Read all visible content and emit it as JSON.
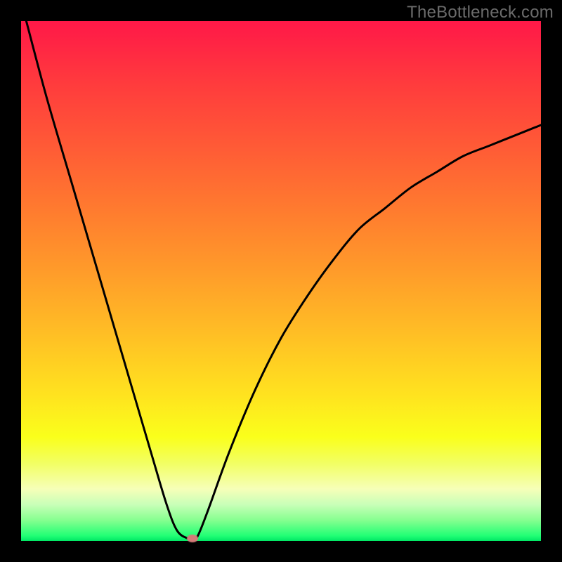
{
  "watermark": "TheBottleneck.com",
  "chart_data": {
    "type": "line",
    "title": "",
    "xlabel": "",
    "ylabel": "",
    "xlim": [
      0,
      100
    ],
    "ylim": [
      0,
      100
    ],
    "grid": false,
    "series": [
      {
        "name": "bottleneck-curve",
        "x": [
          1,
          5,
          10,
          15,
          20,
          25,
          28,
          30,
          32,
          33,
          34,
          36,
          40,
          45,
          50,
          55,
          60,
          65,
          70,
          75,
          80,
          85,
          90,
          95,
          100
        ],
        "values": [
          100,
          85,
          68,
          51,
          34,
          17,
          7,
          2,
          0.5,
          0.5,
          1,
          6,
          17,
          29,
          39,
          47,
          54,
          60,
          64,
          68,
          71,
          74,
          76,
          78,
          80
        ]
      }
    ],
    "marker": {
      "x": 33,
      "y": 0.5,
      "color": "#d47b78"
    },
    "gradient_stops": [
      {
        "pos": 0,
        "color": "#ff1848"
      },
      {
        "pos": 12,
        "color": "#ff3b3d"
      },
      {
        "pos": 24,
        "color": "#ff5a36"
      },
      {
        "pos": 36,
        "color": "#ff7a2f"
      },
      {
        "pos": 48,
        "color": "#ff9b2a"
      },
      {
        "pos": 60,
        "color": "#ffbe25"
      },
      {
        "pos": 72,
        "color": "#ffe31f"
      },
      {
        "pos": 80,
        "color": "#faff1b"
      },
      {
        "pos": 85,
        "color": "#f2ff62"
      },
      {
        "pos": 90,
        "color": "#f6ffb8"
      },
      {
        "pos": 93,
        "color": "#c9ffb8"
      },
      {
        "pos": 96,
        "color": "#86ff90"
      },
      {
        "pos": 99,
        "color": "#22ff75"
      },
      {
        "pos": 100,
        "color": "#00e765"
      }
    ]
  }
}
